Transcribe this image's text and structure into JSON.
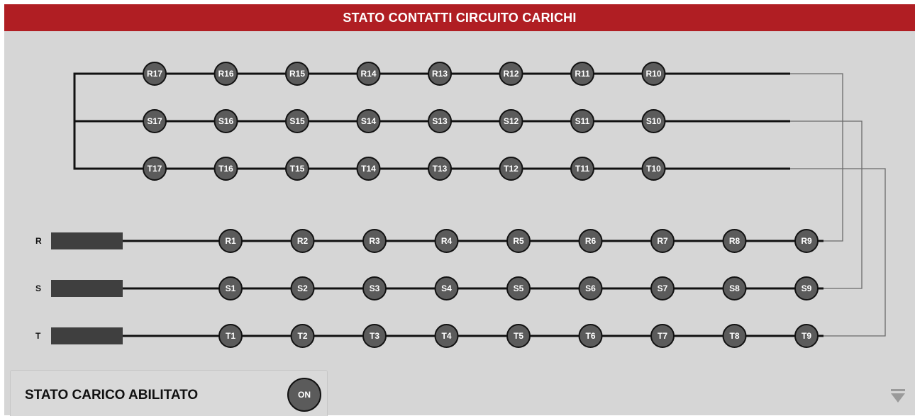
{
  "header": {
    "title": "STATO CONTATTI CIRCUITO CARICHI"
  },
  "upper_rows": [
    {
      "phase": "R",
      "contacts": [
        "R17",
        "R16",
        "R15",
        "R14",
        "R13",
        "R12",
        "R11",
        "R10"
      ]
    },
    {
      "phase": "S",
      "contacts": [
        "S17",
        "S16",
        "S15",
        "S14",
        "S13",
        "S12",
        "S11",
        "S10"
      ]
    },
    {
      "phase": "T",
      "contacts": [
        "T17",
        "T16",
        "T15",
        "T14",
        "T13",
        "T12",
        "T11",
        "T10"
      ]
    }
  ],
  "lower_rows": [
    {
      "label": "R",
      "contacts": [
        "R1",
        "R2",
        "R3",
        "R4",
        "R5",
        "R6",
        "R7",
        "R8",
        "R9"
      ]
    },
    {
      "label": "S",
      "contacts": [
        "S1",
        "S2",
        "S3",
        "S4",
        "S5",
        "S6",
        "S7",
        "S8",
        "S9"
      ]
    },
    {
      "label": "T",
      "contacts": [
        "T1",
        "T2",
        "T3",
        "T4",
        "T5",
        "T6",
        "T7",
        "T8",
        "T9"
      ]
    }
  ],
  "status_panel": {
    "label": "STATO CARICO ABILITATO",
    "button": "ON"
  },
  "colors": {
    "header_red": "#b01e23",
    "background": "#d6d6d6",
    "contact_fill": "#5b5b5b",
    "line": "#111111"
  },
  "icons": {
    "scroll": "triangle-down-icon"
  }
}
